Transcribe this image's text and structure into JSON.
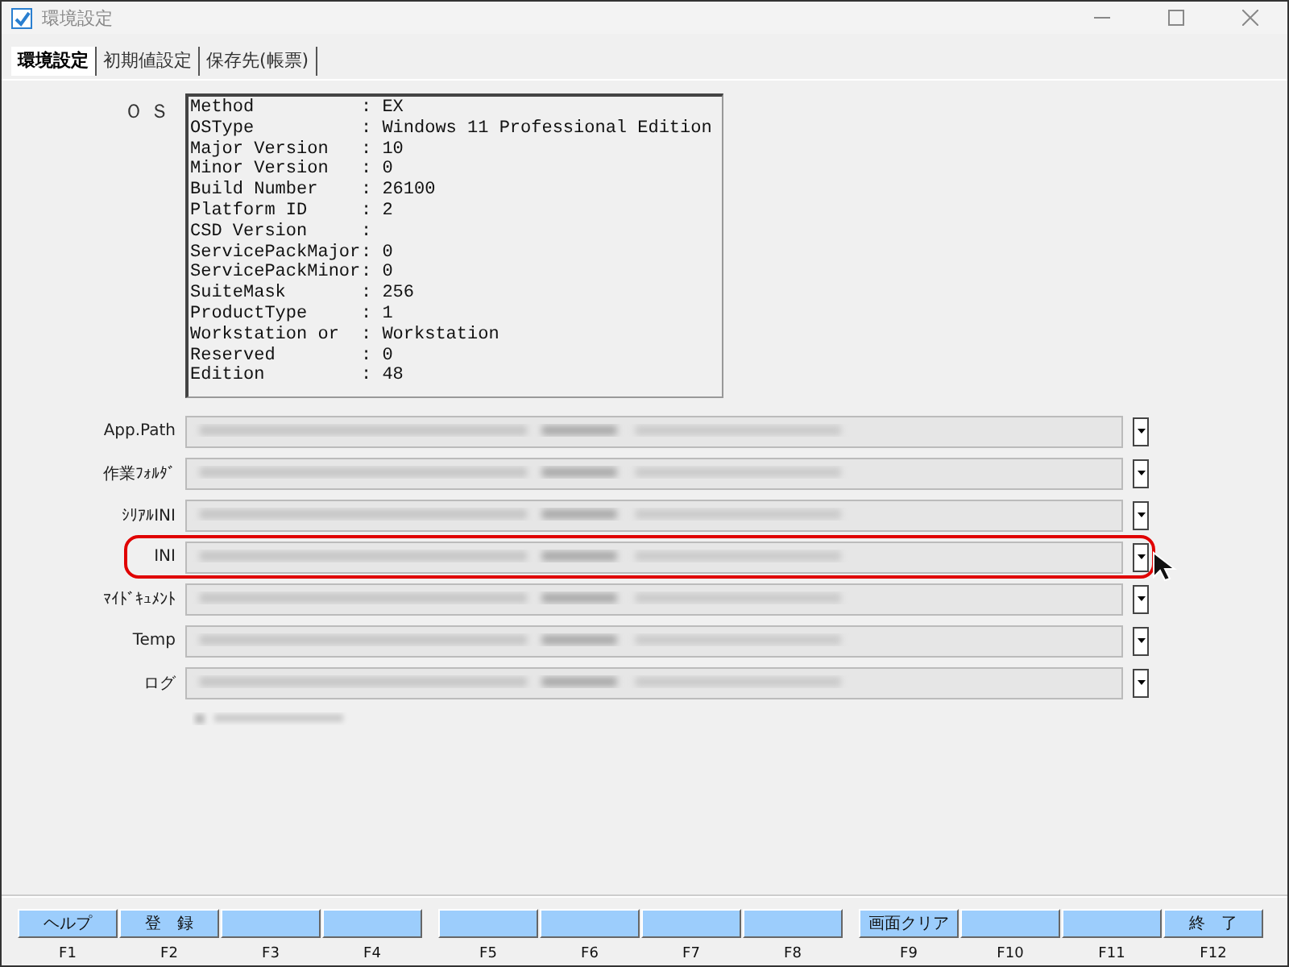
{
  "window": {
    "title": "環境設定"
  },
  "tabs": [
    {
      "label": "環境設定",
      "selected": true
    },
    {
      "label": "初期値設定",
      "selected": false
    },
    {
      "label": "保存先(帳票)",
      "selected": false
    }
  ],
  "os": {
    "label": "ＯＳ",
    "rows": [
      {
        "key": "Method",
        "value": ": EX"
      },
      {
        "key": "OSType",
        "value": ": Windows 11 Professional Edition"
      },
      {
        "key": "Major Version",
        "value": ": 10"
      },
      {
        "key": "Minor Version",
        "value": ": 0"
      },
      {
        "key": "Build Number",
        "value": ": 26100"
      },
      {
        "key": "Platform ID",
        "value": ": 2"
      },
      {
        "key": "CSD Version",
        "value": ":"
      },
      {
        "key": "ServicePackMajor",
        "value": ": 0"
      },
      {
        "key": "ServicePackMinor",
        "value": ": 0"
      },
      {
        "key": "SuiteMask",
        "value": ": 256"
      },
      {
        "key": "ProductType",
        "value": ": 1"
      },
      {
        "key": "Workstation or",
        "value": ": Workstation"
      },
      {
        "key": "Reserved",
        "value": ": 0"
      },
      {
        "key": "Edition",
        "value": ": 48"
      }
    ]
  },
  "fields": [
    {
      "label": "App.Path",
      "highlighted": false
    },
    {
      "label": "作業ﾌｫﾙﾀﾞ",
      "highlighted": false
    },
    {
      "label": "ｼﾘｱﾙINI",
      "highlighted": false
    },
    {
      "label": "INI",
      "highlighted": true
    },
    {
      "label": "ﾏｲﾄﾞｷｭﾒﾝﾄ",
      "highlighted": false
    },
    {
      "label": "Temp",
      "highlighted": false
    },
    {
      "label": "ログ",
      "highlighted": false
    }
  ],
  "function_keys": [
    {
      "label": "ヘルプ",
      "key": "F1"
    },
    {
      "label": "登　録",
      "key": "F2"
    },
    {
      "key": "F3"
    },
    {
      "key": "F4"
    },
    {
      "key": "F5"
    },
    {
      "key": "F6"
    },
    {
      "key": "F7"
    },
    {
      "key": "F8"
    },
    {
      "label": "画面クリア",
      "key": "F9"
    },
    {
      "key": "F10"
    },
    {
      "key": "F11"
    },
    {
      "label": "終　了",
      "key": "F12"
    }
  ]
}
